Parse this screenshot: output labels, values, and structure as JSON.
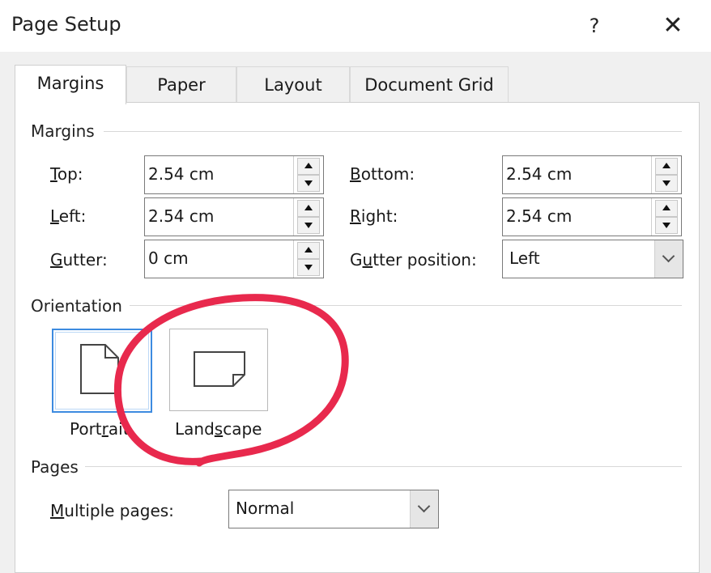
{
  "window": {
    "title": "Page Setup",
    "help_label": "?",
    "close_label": "✕"
  },
  "tabs": [
    {
      "label": "Margins",
      "active": true
    },
    {
      "label": "Paper",
      "active": false
    },
    {
      "label": "Layout",
      "active": false
    },
    {
      "label": "Document Grid",
      "active": false
    }
  ],
  "margins": {
    "section_label": "Margins",
    "top": {
      "accel": "T",
      "rest": "op:",
      "value": "2.54 cm"
    },
    "bottom": {
      "accel": "B",
      "rest": "ottom:",
      "value": "2.54 cm"
    },
    "left": {
      "accel": "L",
      "rest": "eft:",
      "value": "2.54 cm"
    },
    "right": {
      "accel": "R",
      "rest": "ight:",
      "value": "2.54 cm"
    },
    "gutter": {
      "accel": "G",
      "rest": "utter:",
      "value": "0 cm"
    },
    "gutter_position": {
      "pre": "G",
      "accel": "u",
      "rest": "tter position:",
      "value": "Left"
    }
  },
  "orientation": {
    "section_label": "Orientation",
    "portrait": {
      "pre": "Port",
      "accel": "r",
      "rest": "ait",
      "selected": true
    },
    "landscape": {
      "pre": "Land",
      "accel": "s",
      "rest": "cape",
      "selected": false
    }
  },
  "pages": {
    "section_label": "Pages",
    "multiple_pages": {
      "accel": "M",
      "rest": "ultiple pages:",
      "value": "Normal"
    }
  },
  "colors": {
    "selection_border": "#3d8be0",
    "annotation_circle": "#e8294d"
  },
  "icons": [
    "help-icon",
    "close-icon",
    "spin-up-icon",
    "spin-down-icon",
    "chevron-down-icon",
    "portrait-page-icon",
    "landscape-page-icon"
  ]
}
